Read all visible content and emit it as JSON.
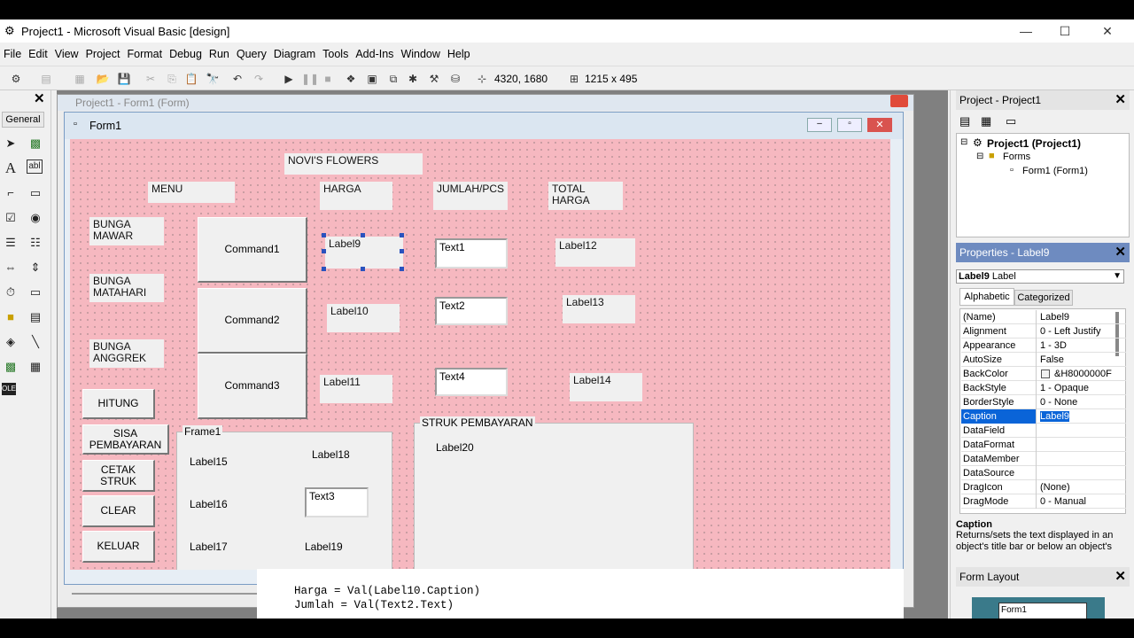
{
  "window": {
    "title": "Project1 - Microsoft Visual Basic [design]",
    "min": "—",
    "max": "☐",
    "close": "✕"
  },
  "menu": [
    "File",
    "Edit",
    "View",
    "Project",
    "Format",
    "Debug",
    "Run",
    "Query",
    "Diagram",
    "Tools",
    "Add-Ins",
    "Window",
    "Help"
  ],
  "toolbar": {
    "position": "4320, 1680",
    "size": "1215 x 495"
  },
  "toolbox": {
    "title": "General"
  },
  "project_window": {
    "title": "Project1 - Form1 (Form)"
  },
  "form": {
    "title": "Form1",
    "header": "NOVI'S FLOWERS",
    "menu_label": "MENU",
    "harga_label": "HARGA",
    "jumlah_label": "JUMLAH/PCS",
    "total_label": "TOTAL HARGA",
    "items": [
      "BUNGA\nMAWAR",
      "BUNGA\nMATAHARI",
      "BUNGA\nANGGREK"
    ],
    "commands": [
      "Command1",
      "Command2",
      "Command3"
    ],
    "price_labels": [
      "Label9",
      "Label10",
      "Label11"
    ],
    "texts": [
      "Text1",
      "Text2",
      "Text4",
      "Text3"
    ],
    "total_labels": [
      "Label12",
      "Label13",
      "Label14"
    ],
    "buttons": [
      "HITUNG",
      "SISA\nPEMBAYARAN",
      "CETAK\nSTRUK",
      "CLEAR",
      "KELUAR"
    ],
    "frame1": {
      "caption": "Frame1",
      "labels": [
        "Label15",
        "Label16",
        "Label17",
        "Label18",
        "Label19"
      ]
    },
    "struk": {
      "caption": "STRUK PEMBAYARAN",
      "label": "Label20"
    }
  },
  "code": [
    "Harga = Val(Label10.Caption)",
    "Jumlah = Val(Text2.Text)"
  ],
  "project_explorer": {
    "title": "Project - Project1",
    "root": "Project1 (Project1)",
    "folder": "Forms",
    "item": "Form1 (Form1)"
  },
  "properties": {
    "title": "Properties - Label9",
    "object_bold": "Label9",
    "object_type": "Label",
    "tabs": [
      "Alphabetic",
      "Categorized"
    ],
    "rows": [
      {
        "k": "(Name)",
        "v": "Label9"
      },
      {
        "k": "Alignment",
        "v": "0 - Left Justify"
      },
      {
        "k": "Appearance",
        "v": "1 - 3D"
      },
      {
        "k": "AutoSize",
        "v": "False"
      },
      {
        "k": "BackColor",
        "v": "&H8000000F"
      },
      {
        "k": "BackStyle",
        "v": "1 - Opaque"
      },
      {
        "k": "BorderStyle",
        "v": "0 - None"
      },
      {
        "k": "Caption",
        "v": "Label9"
      },
      {
        "k": "DataField",
        "v": ""
      },
      {
        "k": "DataFormat",
        "v": ""
      },
      {
        "k": "DataMember",
        "v": ""
      },
      {
        "k": "DataSource",
        "v": ""
      },
      {
        "k": "DragIcon",
        "v": "(None)"
      },
      {
        "k": "DragMode",
        "v": "0 - Manual"
      }
    ],
    "desc_title": "Caption",
    "desc_text": "Returns/sets the text displayed in an object's title bar or below an object's"
  },
  "form_layout": {
    "title": "Form Layout",
    "form": "Form1"
  },
  "colors": {
    "form_bg": "#f6b8c0",
    "selection": "#0a64d8"
  }
}
